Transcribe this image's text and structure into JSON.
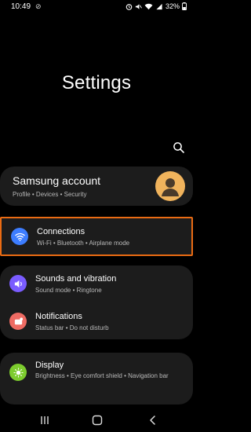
{
  "status": {
    "time": "10:49",
    "battery": "32%"
  },
  "page": {
    "title": "Settings"
  },
  "account": {
    "name": "Samsung account",
    "sub": "Profile  •  Devices  •  Security"
  },
  "items": [
    {
      "label": "Connections",
      "desc": "Wi-Fi  •  Bluetooth  •  Airplane mode",
      "icon": "wifi-icon",
      "color": "#3d7dff"
    },
    {
      "label": "Sounds and vibration",
      "desc": "Sound mode  •  Ringtone",
      "icon": "speaker-icon",
      "color": "#7a5cff"
    },
    {
      "label": "Notifications",
      "desc": "Status bar  •  Do not disturb",
      "icon": "notification-icon",
      "color": "#ee6b63"
    },
    {
      "label": "Display",
      "desc": "Brightness  •  Eye comfort shield  •  Navigation bar",
      "icon": "sun-icon",
      "color": "#7dcc2e"
    }
  ],
  "colors": {
    "highlight": "#ea6b13",
    "card": "#1c1c1c"
  }
}
